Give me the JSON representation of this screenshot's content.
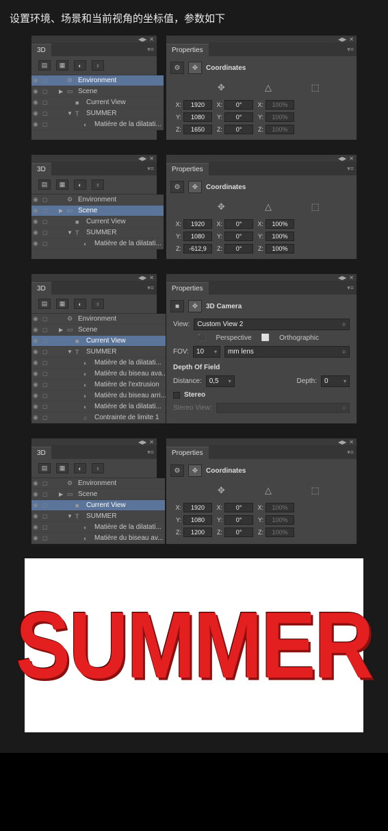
{
  "heading": "设置环境、场景和当前视角的坐标值，参数如下",
  "panels": [
    {
      "tab3d": "3D",
      "tree": [
        {
          "label": "Environment",
          "indent": 0,
          "icon": "⚙",
          "selected": true
        },
        {
          "label": "Scene",
          "indent": 0,
          "icon": "▭",
          "caret": "▶"
        },
        {
          "label": "Current View",
          "indent": 1,
          "icon": "■"
        },
        {
          "label": "SUMMER",
          "indent": 1,
          "icon": "T",
          "caret": "▼"
        },
        {
          "label": "Matière de la dilatati...",
          "indent": 2,
          "icon": "◐"
        }
      ],
      "prop_tab": "Properties",
      "setname": "Coordinates",
      "rows": [
        {
          "a": "X:",
          "av": "1920",
          "b": "X:",
          "bv": "0°",
          "c": "X:",
          "cv": "100%",
          "cdis": true
        },
        {
          "a": "Y:",
          "av": "1080",
          "b": "Y:",
          "bv": "0°",
          "c": "Y:",
          "cv": "100%",
          "cdis": true
        },
        {
          "a": "Z:",
          "av": "1650",
          "b": "Z:",
          "bv": "0°",
          "c": "Z:",
          "cv": "100%",
          "cdis": true
        }
      ]
    },
    {
      "tab3d": "3D",
      "tree": [
        {
          "label": "Environment",
          "indent": 0,
          "icon": "⚙"
        },
        {
          "label": "Scene",
          "indent": 0,
          "icon": "▭",
          "selected": true,
          "caret": "▶"
        },
        {
          "label": "Current View",
          "indent": 1,
          "icon": "■"
        },
        {
          "label": "SUMMER",
          "indent": 1,
          "icon": "T",
          "caret": "▼"
        },
        {
          "label": "Matière de la dilatati...",
          "indent": 2,
          "icon": "◐"
        }
      ],
      "prop_tab": "Properties",
      "setname": "Coordinates",
      "rows": [
        {
          "a": "X:",
          "av": "1920",
          "b": "X:",
          "bv": "0°",
          "c": "X:",
          "cv": "100%"
        },
        {
          "a": "Y:",
          "av": "1080",
          "b": "Y:",
          "bv": "0°",
          "c": "Y:",
          "cv": "100%"
        },
        {
          "a": "Z:",
          "av": "-612,9",
          "b": "Z:",
          "bv": "0°",
          "c": "Z:",
          "cv": "100%"
        }
      ]
    },
    {
      "tab3d": "3D",
      "tree": [
        {
          "label": "Environment",
          "indent": 0,
          "icon": "⚙"
        },
        {
          "label": "Scene",
          "indent": 0,
          "icon": "▭",
          "caret": "▶"
        },
        {
          "label": "Current View",
          "indent": 1,
          "icon": "■",
          "selected": true
        },
        {
          "label": "SUMMER",
          "indent": 1,
          "icon": "T",
          "caret": "▼"
        },
        {
          "label": "Matière de la dilatati...",
          "indent": 2,
          "icon": "◐"
        },
        {
          "label": "Matière du biseau ava...",
          "indent": 2,
          "icon": "◐"
        },
        {
          "label": "Matière de l'extrusion",
          "indent": 2,
          "icon": "◐"
        },
        {
          "label": "Matière du biseau arri...",
          "indent": 2,
          "icon": "◐"
        },
        {
          "label": "Matière de la dilatati...",
          "indent": 2,
          "icon": "◐"
        },
        {
          "label": "Contrainte de limite 1",
          "indent": 2,
          "icon": "○"
        }
      ],
      "prop_tab": "Properties",
      "camera": {
        "title": "3D Camera",
        "view_label": "View:",
        "view_value": "Custom View 2",
        "perspective": "Perspective",
        "orthographic": "Orthographic",
        "fov_label": "FOV:",
        "fov_value": "10",
        "lens": "mm lens",
        "dof_title": "Depth Of Field",
        "distance_label": "Distance:",
        "distance_value": "0,5",
        "depth_label": "Depth:",
        "depth_value": "0",
        "stereo_label": "Stereo",
        "stereo_view_label": "Stereo View:"
      }
    },
    {
      "tab3d": "3D",
      "tree": [
        {
          "label": "Environment",
          "indent": 0,
          "icon": "⚙"
        },
        {
          "label": "Scene",
          "indent": 0,
          "icon": "▭",
          "caret": "▶"
        },
        {
          "label": "Current View",
          "indent": 1,
          "icon": "■",
          "selected": true
        },
        {
          "label": "SUMMER",
          "indent": 1,
          "icon": "T",
          "caret": "▼"
        },
        {
          "label": "Matière de la dilatati...",
          "indent": 2,
          "icon": "◐"
        },
        {
          "label": "Matière du biseau av...",
          "indent": 2,
          "icon": "◐"
        }
      ],
      "prop_tab": "Properties",
      "setname": "Coordinates",
      "rows": [
        {
          "a": "X:",
          "av": "1920",
          "b": "X:",
          "bv": "0°",
          "c": "X:",
          "cv": "100%",
          "cdis": true
        },
        {
          "a": "Y:",
          "av": "1080",
          "b": "Y:",
          "bv": "0°",
          "c": "Y:",
          "cv": "100%",
          "cdis": true
        },
        {
          "a": "Z:",
          "av": "1200",
          "b": "Z:",
          "bv": "0°",
          "c": "Z:",
          "cv": "100%",
          "cdis": true
        }
      ]
    }
  ],
  "preview_text": "SUMMER"
}
